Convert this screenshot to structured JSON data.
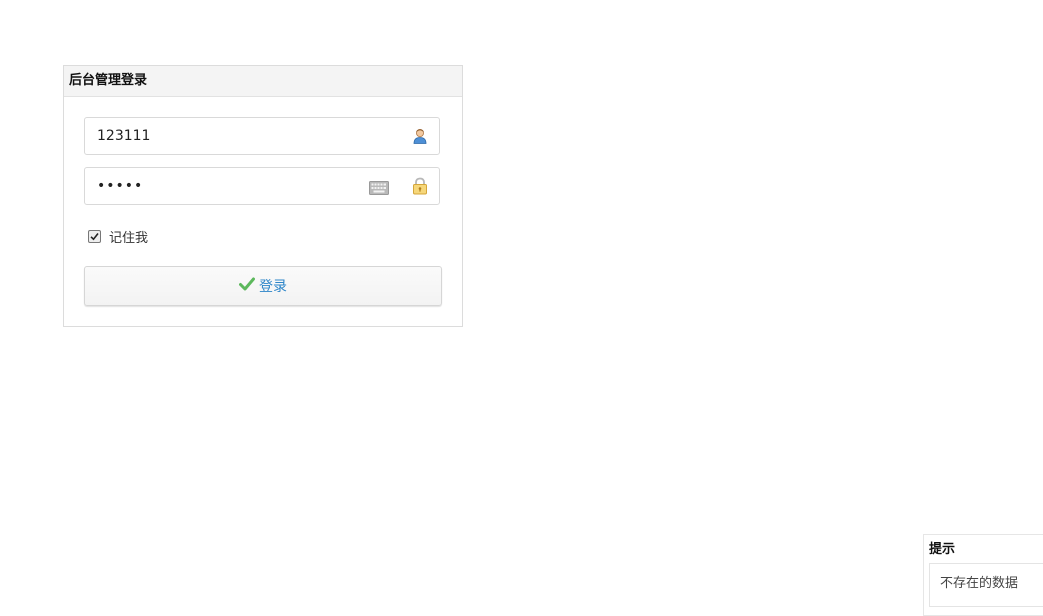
{
  "login": {
    "title": "后台管理登录",
    "username": {
      "value": "123111",
      "placeholder": ""
    },
    "password": {
      "value": "•••••",
      "placeholder": ""
    },
    "remember_label": "记住我",
    "remember_checked": true,
    "submit_label": "登录",
    "icons": {
      "username": "user-icon",
      "keyboard": "keyboard-icon",
      "password": "lock-icon",
      "submit": "checkmark-icon"
    },
    "colors": {
      "submit_text": "#2e86c9",
      "check_icon": "#5cb85c"
    }
  },
  "tip": {
    "title": "提示",
    "message": "不存在的数据"
  }
}
